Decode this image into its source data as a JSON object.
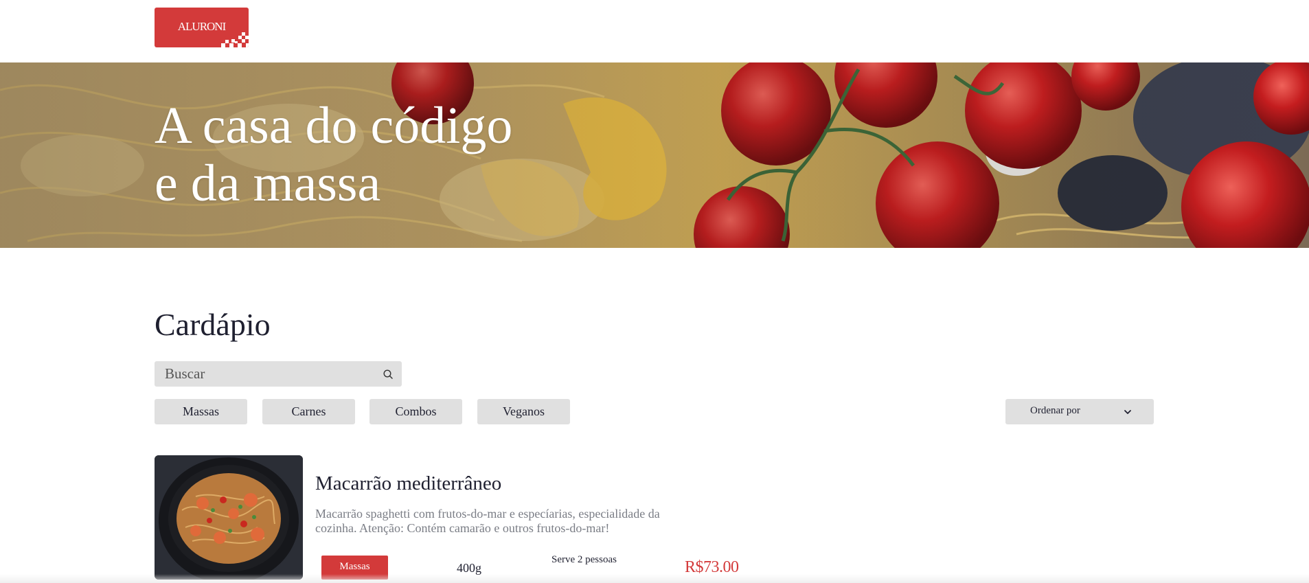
{
  "header": {
    "logo_text": "ALURONI"
  },
  "banner": {
    "title_line1": "A casa do código",
    "title_line2": "e da massa"
  },
  "menu": {
    "title": "Cardápio",
    "search": {
      "placeholder": "Buscar",
      "value": ""
    },
    "filters": [
      "Massas",
      "Carnes",
      "Combos",
      "Veganos"
    ],
    "order_label": "Ordenar por"
  },
  "items": [
    {
      "name": "Macarrão mediterrâneo",
      "description": "Macarrão spaghetti com frutos-do-mar e especíarias, especialidade da cozinha. Atenção: Contém camarão e outros frutos-do-mar!",
      "category": "Massas",
      "size": "400g",
      "serving": "Serve 2 pessoas",
      "price": "R$73.00"
    }
  ],
  "colors": {
    "accent": "#d33a3a",
    "filter_bg": "#e0e0e0",
    "text_dark": "#1f2030",
    "text_muted": "#7a7d85"
  },
  "icons": {
    "search": "search-icon",
    "order": "chevron-down-icon"
  }
}
